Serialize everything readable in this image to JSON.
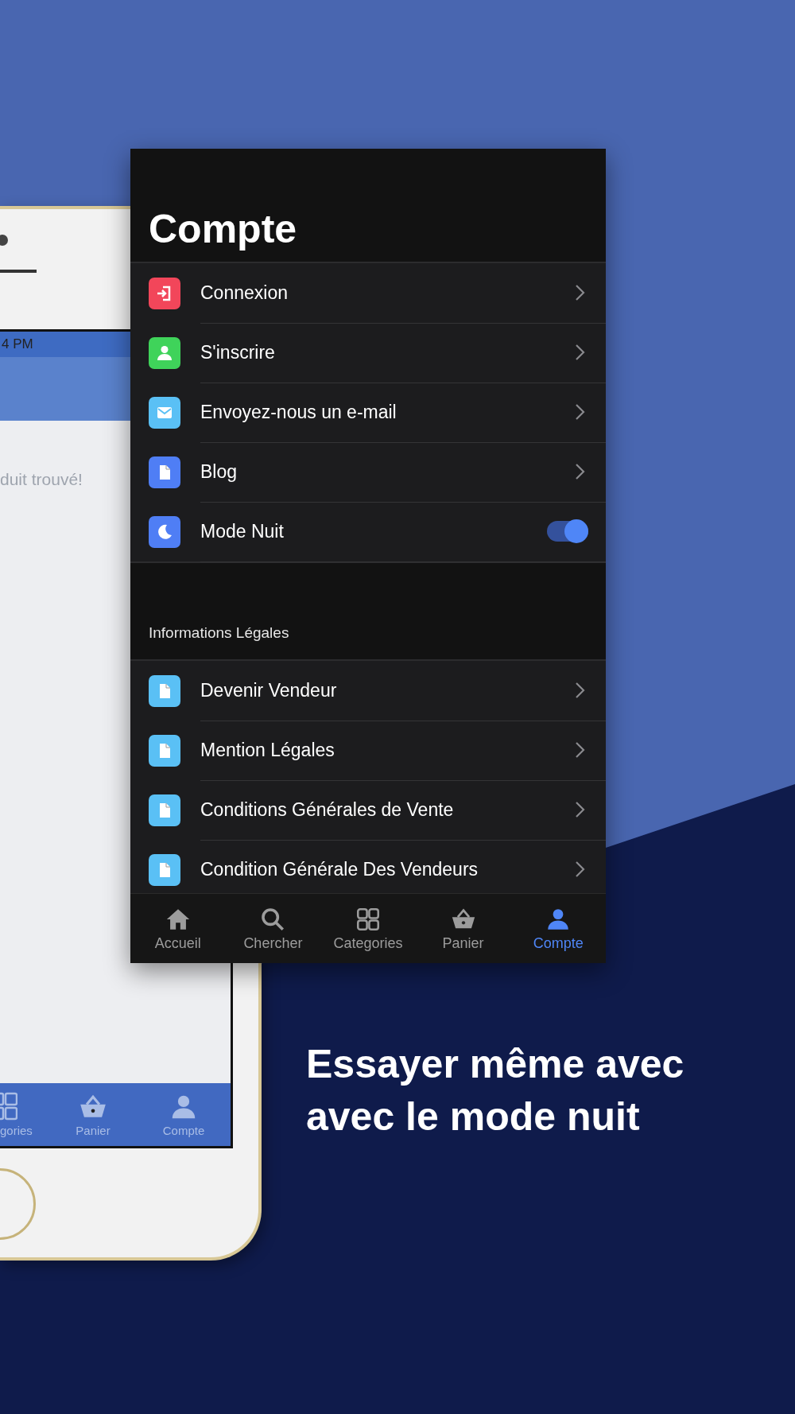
{
  "left_phone": {
    "status_time": "4 PM",
    "empty_message": "duit trouvé!",
    "tabs": [
      {
        "label": "gories",
        "selected": false
      },
      {
        "label": "Panier",
        "selected": false
      },
      {
        "label": "Compte",
        "selected": false
      }
    ]
  },
  "screen": {
    "title": "Compte",
    "sections": [
      {
        "items": [
          {
            "label": "Connexion",
            "color": "#f2465a",
            "kind": "link"
          },
          {
            "label": "S'inscrire",
            "color": "#3fd35a",
            "kind": "link"
          },
          {
            "label": "Envoyez-nous un e-mail",
            "color": "#5ac0f5",
            "kind": "link"
          },
          {
            "label": "Blog",
            "color": "#4f7ef5",
            "kind": "link"
          },
          {
            "label": "Mode Nuit",
            "color": "#4f7ef5",
            "kind": "toggle",
            "on": true
          }
        ]
      },
      {
        "header": "Informations Légales",
        "items": [
          {
            "label": "Devenir Vendeur",
            "color": "#5ac0f5",
            "kind": "link"
          },
          {
            "label": "Mention Légales",
            "color": "#5ac0f5",
            "kind": "link"
          },
          {
            "label": "Conditions Générales de Vente",
            "color": "#5ac0f5",
            "kind": "link"
          },
          {
            "label": "Condition Générale Des Vendeurs",
            "color": "#5ac0f5",
            "kind": "link"
          }
        ]
      }
    ],
    "tab_bar": [
      {
        "label": "Accueil",
        "selected": false
      },
      {
        "label": "Chercher",
        "selected": false
      },
      {
        "label": "Categories",
        "selected": false
      },
      {
        "label": "Panier",
        "selected": false
      },
      {
        "label": "Compte",
        "selected": true
      }
    ]
  },
  "caption": [
    "Essayer même avec",
    "avec le mode nuit"
  ]
}
